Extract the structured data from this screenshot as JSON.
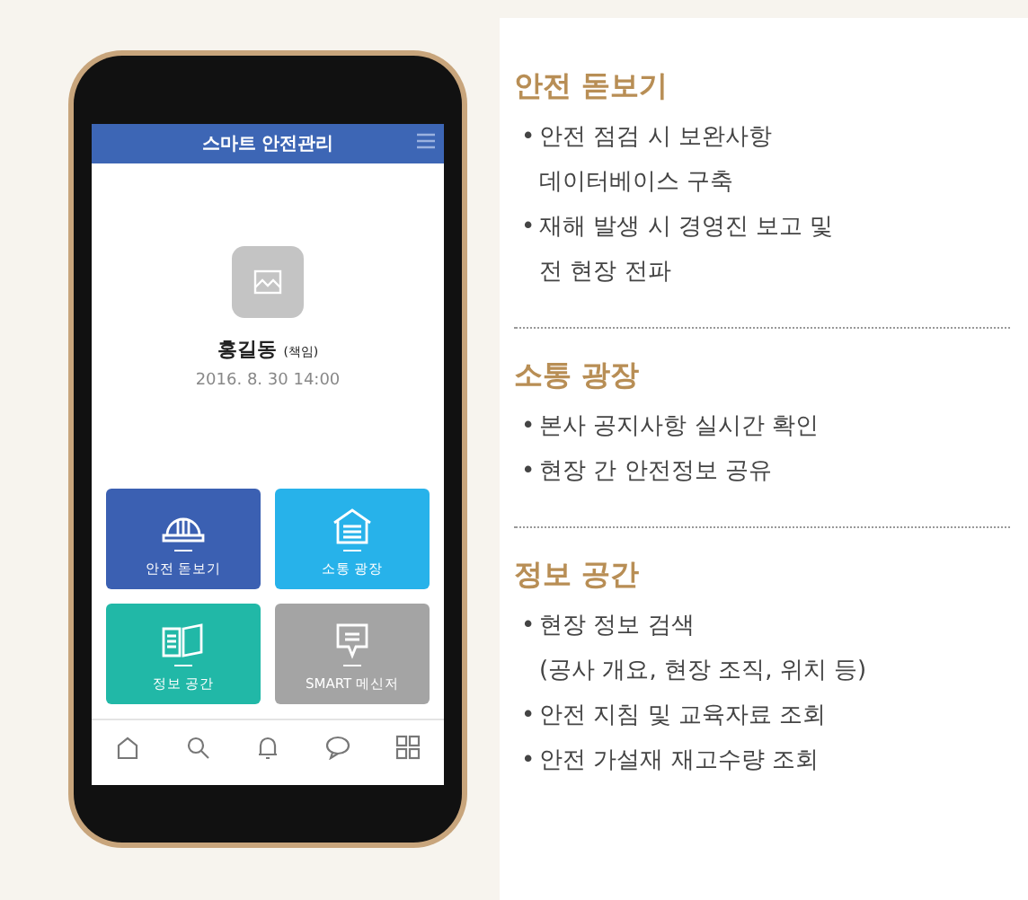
{
  "app": {
    "title": "스마트 안전관리",
    "user_name": "홍길동",
    "user_role": "(책임)",
    "timestamp": "2016. 8. 30 14:00",
    "tiles": [
      {
        "label": "안전 돋보기",
        "color": "#3b60b2"
      },
      {
        "label": "소통 광장",
        "color": "#27b2ea"
      },
      {
        "label": "정보 공간",
        "color": "#21b8a7"
      },
      {
        "label": "SMART 메신저",
        "color": "#a4a4a4"
      }
    ]
  },
  "sections": [
    {
      "title": "안전 돋보기",
      "items": [
        {
          "bullet": "•",
          "text": "안전 점검 시 보완사항\n데이터베이스 구축"
        },
        {
          "bullet": "•",
          "text": "재해 발생 시 경영진 보고 및\n전 현장 전파"
        }
      ]
    },
    {
      "title": "소통 광장",
      "items": [
        {
          "bullet": "•",
          "text": "본사 공지사항 실시간 확인"
        },
        {
          "bullet": "•",
          "text": "현장 간 안전정보 공유"
        }
      ]
    },
    {
      "title": "정보 공간",
      "items": [
        {
          "bullet": "•",
          "text": "현장 정보 검색\n(공사 개요, 현장 조직, 위치 등)"
        },
        {
          "bullet": "•",
          "text": "안전 지침 및 교육자료 조회"
        },
        {
          "bullet": "•",
          "text": "안전 가설재 재고수량 조회"
        }
      ]
    }
  ]
}
